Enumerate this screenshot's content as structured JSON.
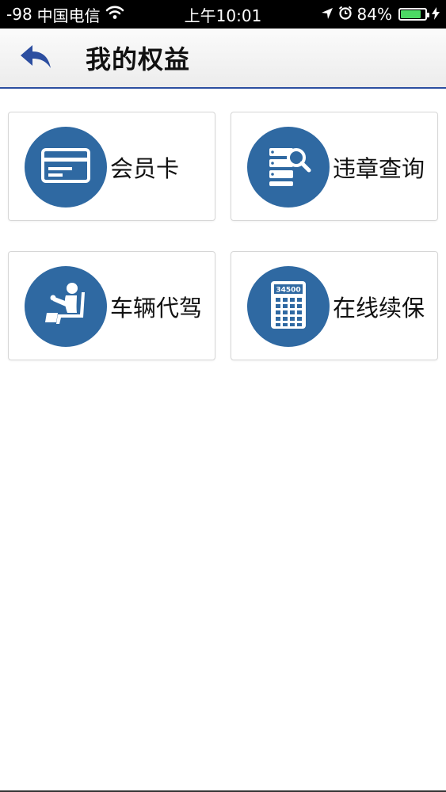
{
  "status_bar": {
    "signal": "-98",
    "carrier": "中国电信",
    "time": "上午10:01",
    "battery_percent": "84%",
    "battery_level": 0.84,
    "icons": [
      "wifi-icon",
      "location-arrow-icon",
      "alarm-clock-icon",
      "battery-icon",
      "charging-bolt-icon"
    ]
  },
  "nav": {
    "title": "我的权益",
    "back_icon": "back-arrow-icon"
  },
  "tiles": [
    {
      "label": "会员卡",
      "icon": "membership-card-icon"
    },
    {
      "label": "违章查询",
      "icon": "violation-search-icon"
    },
    {
      "label": "车辆代驾",
      "icon": "driver-seat-icon"
    },
    {
      "label": "在线续保",
      "icon": "calculator-icon",
      "icon_text": "34500"
    }
  ],
  "colors": {
    "accent": "#2f69a2",
    "nav_border": "#2c4ea0",
    "back_arrow": "#2c4ea0",
    "battery": "#4cd964"
  }
}
